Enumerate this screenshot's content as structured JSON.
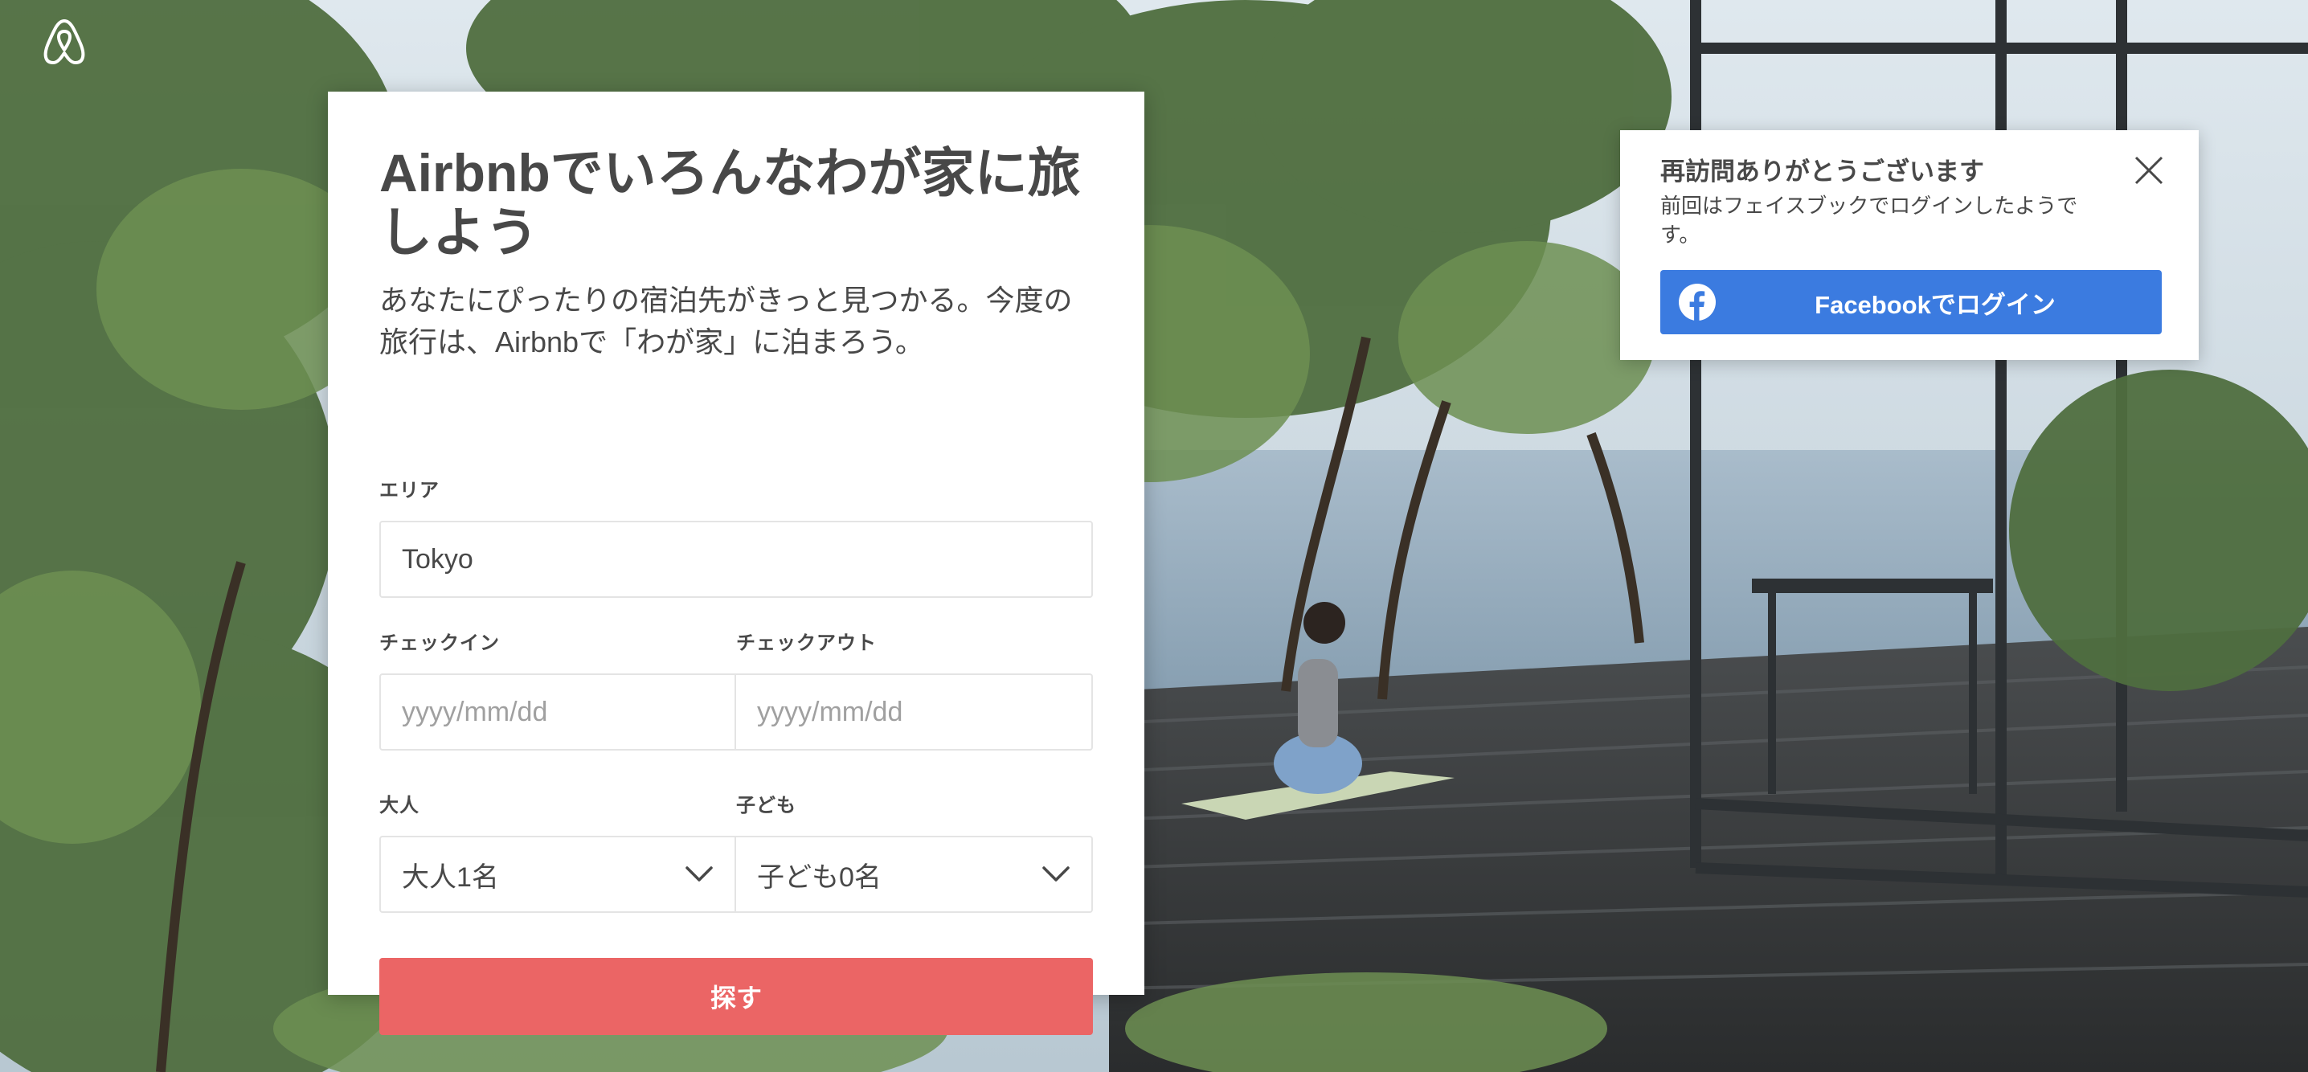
{
  "hero": {
    "title": "Airbnbでいろんなわが家に旅しよう",
    "subtitle": "あなたにぴったりの宿泊先がきっと見つかる。今度の旅行は、Airbnbで「わが家」に泊まろう。"
  },
  "search": {
    "area_label": "エリア",
    "area_value": "Tokyo",
    "checkin_label": "チェックイン",
    "checkin_placeholder": "yyyy/mm/dd",
    "checkout_label": "チェックアウト",
    "checkout_placeholder": "yyyy/mm/dd",
    "adults_label": "大人",
    "adults_value": "大人1名",
    "children_label": "子ども",
    "children_value": "子ども0名",
    "submit_label": "探す"
  },
  "welcome": {
    "title": "再訪問ありがとうございます",
    "text": "前回はフェイスブックでログインしたようです。",
    "facebook_button": "Facebookでログイン"
  },
  "colors": {
    "search_button": "#eb6565",
    "facebook_button": "#3b7be0",
    "text": "#484848"
  },
  "icons": [
    "airbnb-logo-icon",
    "chevron-down-icon",
    "close-icon",
    "facebook-icon"
  ]
}
